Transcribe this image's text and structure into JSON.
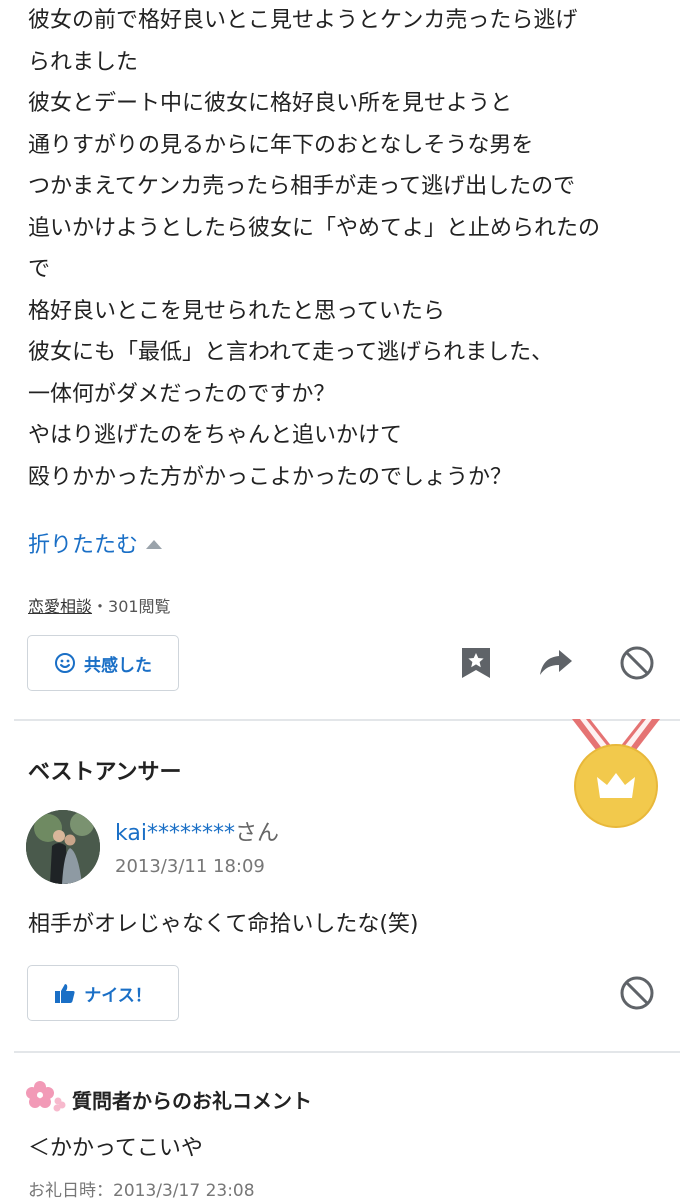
{
  "question": {
    "lines": [
      "彼女の前で格好良いとこ見せようとケンカ売ったら逃げ",
      "られました",
      "彼女とデート中に彼女に格好良い所を見せようと",
      "通りすがりの見るからに年下のおとなしそうな男を",
      "つかまえてケンカ売ったら相手が走って逃げ出したので",
      "追いかけようとしたら彼女に「やめてよ」と止められたの",
      "で",
      "格好良いとこを見せられたと思っていたら",
      "彼女にも「最低」と言われて走って逃げられました、",
      "一体何がダメだったのですか？",
      "やはり逃げたのをちゃんと追いかけて",
      "殴りかかった方がかっこよかったのでしょうか？"
    ],
    "collapse_label": "折りたたむ",
    "category": "恋愛相談",
    "views": "・301閲覧",
    "empathy_label": "共感した"
  },
  "best_answer": {
    "heading": "ベストアンサー",
    "username": "kai********",
    "honorific": "さん",
    "date": "2013/3/11 18:09",
    "text": "相手がオレじゃなくて命拾いしたな(笑)",
    "nice_label": "ナイス！"
  },
  "thanks": {
    "heading": "質問者からのお礼コメント",
    "text": "＜かかってこいや",
    "date": "お礼日時：2013/3/17 23:08"
  },
  "colors": {
    "link_blue": "#1a6fc6",
    "medal_gold": "#f2c94c",
    "ribbon_red": "#e57373"
  },
  "icons": [
    "smile-icon",
    "bookmark-star-icon",
    "share-arrow-icon",
    "block-icon",
    "medal-crown-icon",
    "thumbs-up-icon",
    "sakura-icon",
    "chevron-up-icon"
  ]
}
